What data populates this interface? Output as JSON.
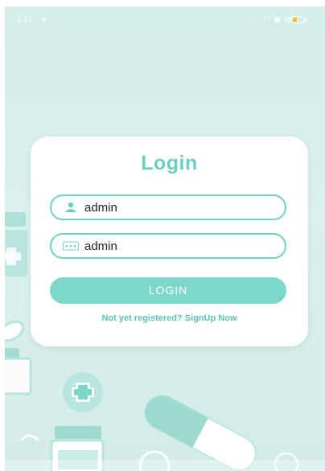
{
  "status_bar": {
    "time": "2:11",
    "left_icons": "● ···",
    "right_icons": "... ◠ ▣ ▥ul"
  },
  "login_card": {
    "title": "Login",
    "username": {
      "value": "admin",
      "icon": "person-icon"
    },
    "password": {
      "value": "admin",
      "icon": "password-dots-icon"
    },
    "button_label": "LOGIN",
    "signup_text": "Not yet registered? SignUp Now"
  },
  "colors": {
    "accent": "#6ccfc0",
    "button": "#7dd8ca",
    "background": "#d4eeea",
    "link": "#5fc3b3"
  }
}
